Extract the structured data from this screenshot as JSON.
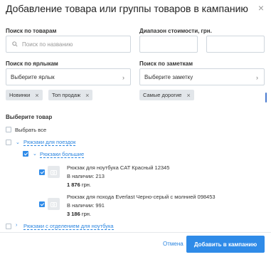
{
  "modal": {
    "title": "Добавление товара или группы товаров в кампанию",
    "close": "×"
  },
  "search_products": {
    "label": "Поиск по товарам",
    "placeholder": "Поиск по названию"
  },
  "price_range": {
    "label": "Диапазон стоимости, грн."
  },
  "labels_filter": {
    "label": "Поиск по ярлыкам",
    "select_value": "Выберите ярлык",
    "tags": [
      "Новинки",
      "Топ продаж"
    ]
  },
  "notes_filter": {
    "label": "Поиск по заметкам",
    "select_value": "Выберите заметку",
    "tags": [
      "Самые дорогие"
    ]
  },
  "products": {
    "label": "Выберите товар",
    "select_all": "Выбрать все",
    "groups": [
      {
        "name": "Рюкзаки для поездок",
        "expanded": true,
        "checked": false
      },
      {
        "name": "Рюкзаки большие",
        "expanded": true,
        "checked": true
      },
      {
        "name": "Рюкзаки с отделением для ноутбука",
        "expanded": false,
        "checked": false
      }
    ],
    "items": [
      {
        "name": "Рюкзак для ноутбука CAT Красный 12345",
        "stock": "В наличии: 213",
        "price": "1 876",
        "currency": "грн.",
        "checked": true
      },
      {
        "name": "Рюкзак для похода Everlast Черно-серый с молнией 098453",
        "stock": "В наличии: 991",
        "price": "3 186",
        "currency": "грн.",
        "checked": true
      }
    ]
  },
  "footer": {
    "cancel": "Отмена",
    "submit": "Добавить в кампанию"
  },
  "colors": {
    "accent": "#2f8be8",
    "link": "#2a85e0",
    "tag_bg": "#e2e6ea"
  }
}
